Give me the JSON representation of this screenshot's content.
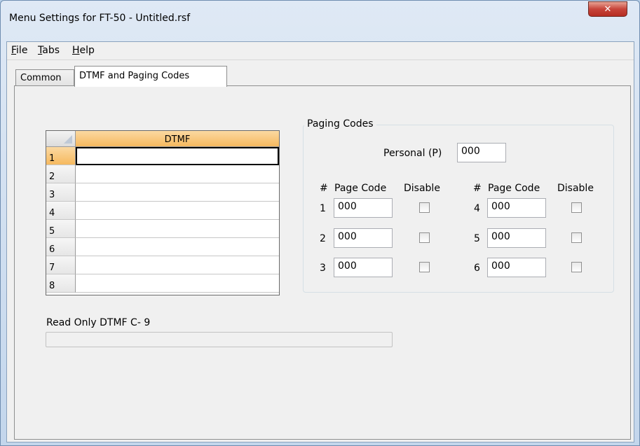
{
  "window": {
    "title": "Menu Settings for FT-50 - Untitled.rsf",
    "close_glyph": "✕"
  },
  "menu": [
    {
      "mnemonic": "F",
      "rest": "ile"
    },
    {
      "mnemonic": "T",
      "rest": "abs"
    },
    {
      "mnemonic": "H",
      "rest": "elp"
    }
  ],
  "tabs": {
    "common": "Common",
    "dtmf": "DTMF and Paging Codes"
  },
  "dtmf_grid": {
    "header": "DTMF",
    "rows": [
      "1",
      "2",
      "3",
      "4",
      "5",
      "6",
      "7",
      "8"
    ],
    "values": [
      "",
      "",
      "",
      "",
      "",
      "",
      "",
      ""
    ]
  },
  "read_only": {
    "label": "Read Only DTMF C- 9",
    "value": ""
  },
  "paging": {
    "group_title": "Paging Codes",
    "personal_label": "Personal (P)",
    "personal_value": "000",
    "col_hash": "#",
    "col_page_code": "Page Code",
    "col_disable": "Disable",
    "codes": [
      {
        "num": "1",
        "value": "000"
      },
      {
        "num": "2",
        "value": "000"
      },
      {
        "num": "3",
        "value": "000"
      },
      {
        "num": "4",
        "value": "000"
      },
      {
        "num": "5",
        "value": "000"
      },
      {
        "num": "6",
        "value": "000"
      }
    ]
  }
}
